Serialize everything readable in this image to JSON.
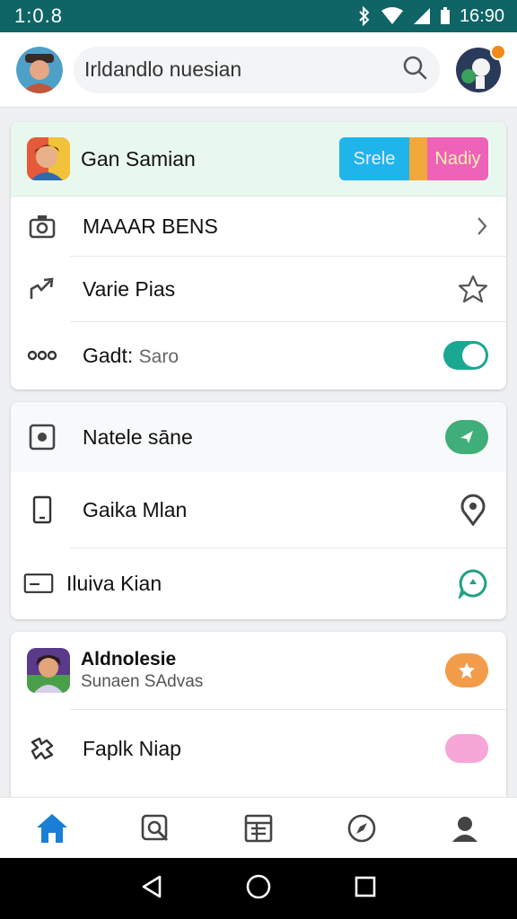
{
  "status_bar": {
    "time_left": "1:0.8",
    "time_right": "16:90"
  },
  "top_bar": {
    "search_value": "Irldandlo nuesian"
  },
  "card1": {
    "profile": {
      "name": "Gan Samian",
      "chip_a": "Srele",
      "chip_b": "Nadiy"
    },
    "rows": [
      {
        "label": "MAAAR BENS",
        "icon": "camera-icon",
        "trail": "chevron-right-icon"
      },
      {
        "label": "Varie Pias",
        "icon": "trend-arrow-icon",
        "trail": "star-icon"
      },
      {
        "label": "Gadt:",
        "secondary": "Saro",
        "icon": "dots-icon",
        "trail": "toggle-on"
      }
    ]
  },
  "card2": {
    "rows": [
      {
        "label": "Natele sāne",
        "icon": "square-dot-icon",
        "trail": "send-icon",
        "pill_color": "#3fae78"
      },
      {
        "label": "Gaika Mlan",
        "icon": "phone-icon",
        "trail": "location-pin-icon"
      },
      {
        "label": "Iluiva Kian",
        "icon": "card-icon",
        "trail": "chat-icon"
      }
    ]
  },
  "card3": {
    "rows": [
      {
        "title": "Aldnolesie",
        "subtitle": "Sunaen SAdvas",
        "trail": "star-badge-icon",
        "pill_color": "#f29c4a"
      },
      {
        "label": "Faplk Niap",
        "icon": "puzzle-icon",
        "trail": "pink-pill",
        "pill_color": "#f7a6d8"
      }
    ]
  },
  "bottom_nav": [
    "home-icon",
    "search-doc-icon",
    "list-icon",
    "compass-icon",
    "profile-icon"
  ],
  "colors": {
    "status_bar": "#0f6466",
    "accent_blue": "#1a7fd6",
    "toggle_teal": "#1aa893"
  }
}
